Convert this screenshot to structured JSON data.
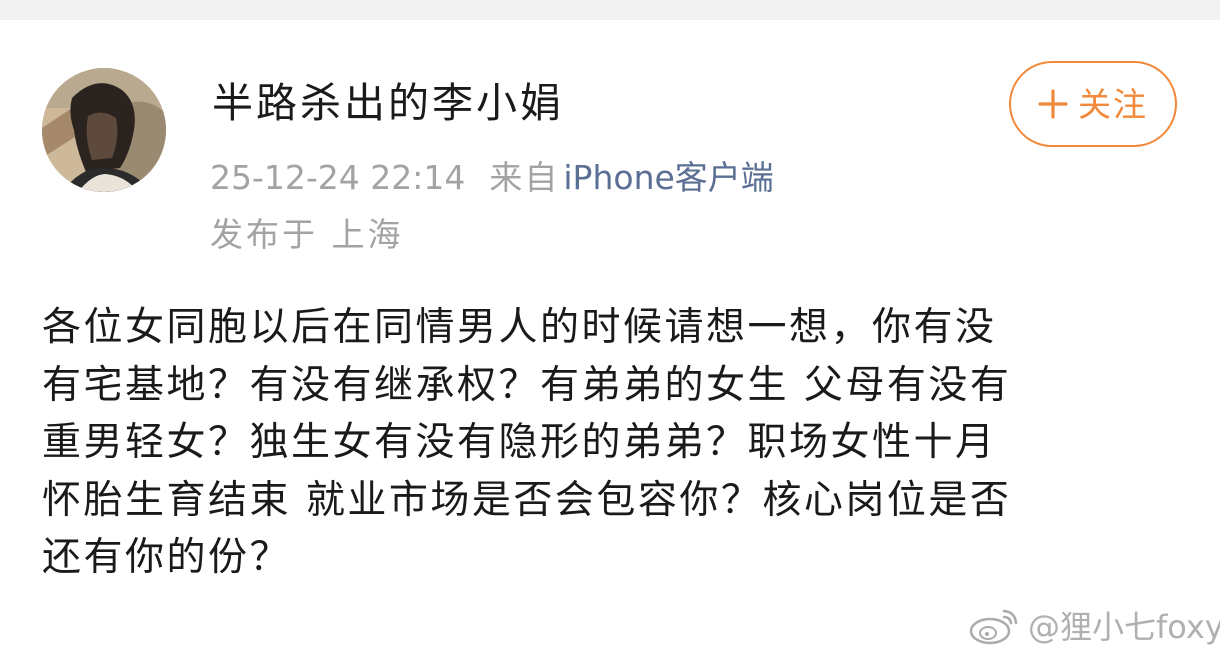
{
  "post": {
    "author_name": "半路杀出的李小娟",
    "follow_label": "关注",
    "timestamp": "25-12-24 22:14",
    "source_prefix": "来自",
    "source_client": "iPhone客户端",
    "location": "发布于 上海",
    "text": "各位女同胞以后在同情男人的时候请想一想，你有没\n有宅基地？有没有继承权？有弟弟的女生 父母有没有\n重男轻女？独生女有没有隐形的弟弟？职场女性十月\n怀胎生育结束 就业市场是否会包容你？核心岗位是否\n还有你的份？"
  },
  "watermark": {
    "handle": "@狸小七foxy"
  },
  "colors": {
    "accent_orange": "#f2883a",
    "link_blue": "#5a6f93",
    "meta_gray": "#a3a3a3"
  },
  "icons": {
    "follow": "plus-icon",
    "avatar": "user-avatar",
    "watermark": "weibo-logo-icon"
  }
}
